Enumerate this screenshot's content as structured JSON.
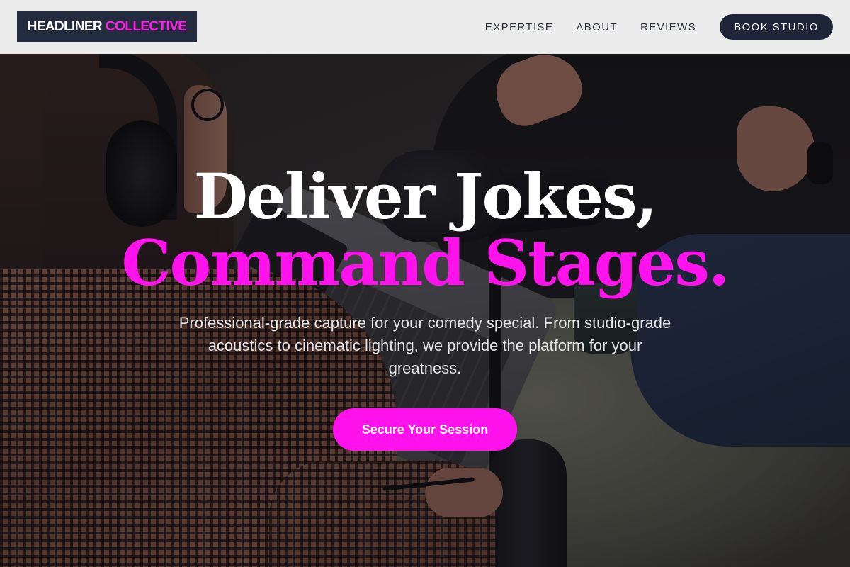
{
  "brand": {
    "name_part1": "HEADLINER",
    "name_part2": "COLLECTIVE",
    "primary_color": "#232b3e",
    "accent_color": "#ff12ec"
  },
  "nav": {
    "links": [
      {
        "label": "EXPERTISE"
      },
      {
        "label": "ABOUT"
      },
      {
        "label": "REVIEWS"
      }
    ],
    "cta_label": "BOOK STUDIO"
  },
  "hero": {
    "headline_line1": "Deliver Jokes,",
    "headline_line2": "Command Stages.",
    "subtext": "Professional-grade capture for your comedy special. From studio-grade acoustics to cinematic lighting, we provide the platform for your greatness.",
    "cta_label": "Secure Your Session",
    "background_image": "podcast-recording-photo"
  }
}
